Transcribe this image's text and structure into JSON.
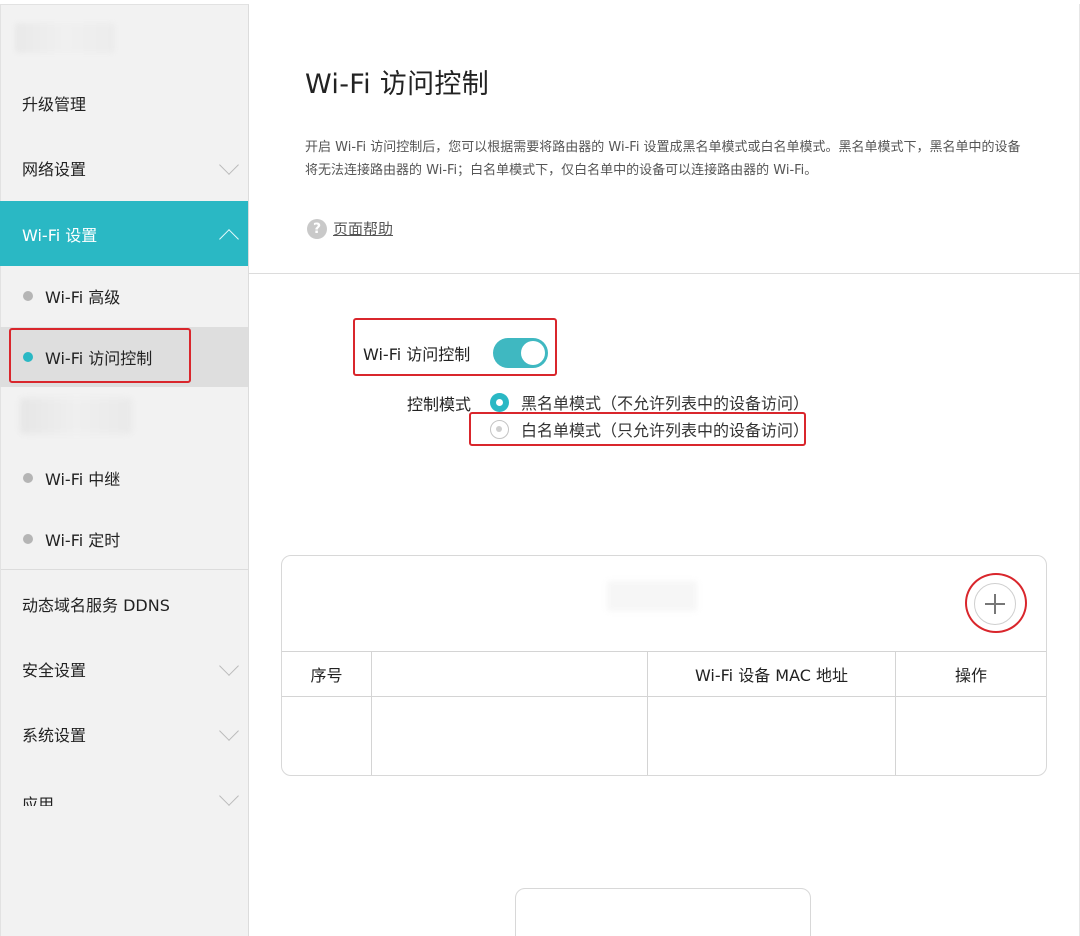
{
  "sidebar": {
    "items": [
      {
        "label": "升级管理"
      },
      {
        "label": "网络设置"
      },
      {
        "label": "Wi-Fi 设置"
      },
      {
        "label": "动态域名服务 DDNS"
      },
      {
        "label": "安全设置"
      },
      {
        "label": "系统设置"
      },
      {
        "label": "应用"
      }
    ],
    "wifi_sub": [
      {
        "label": "Wi-Fi 高级"
      },
      {
        "label": "Wi-Fi 访问控制"
      },
      {
        "label": "Wi-Fi 中继"
      },
      {
        "label": "Wi-Fi 定时"
      }
    ]
  },
  "main": {
    "title": "Wi-Fi 访问控制",
    "description": "开启 Wi-Fi 访问控制后，您可以根据需要将路由器的 Wi-Fi 设置成黑名单模式或白名单模式。黑名单模式下，黑名单中的设备将无法连接路由器的 Wi-Fi；白名单模式下，仅白名单中的设备可以连接路由器的 Wi-Fi。",
    "help_label": "页面帮助",
    "help_icon": "?",
    "control_label": "Wi-Fi 访问控制",
    "toggle_on": true,
    "mode_label": "控制模式",
    "modes": [
      {
        "label": "黑名单模式（不允许列表中的设备访问）",
        "selected": true
      },
      {
        "label": "白名单模式（只允许列表中的设备访问）",
        "selected": false
      }
    ],
    "table": {
      "columns": [
        "序号",
        "",
        "Wi-Fi 设备 MAC 地址",
        "操作"
      ]
    }
  },
  "colors": {
    "accent": "#2ab8c4",
    "highlight": "#d9262c"
  }
}
